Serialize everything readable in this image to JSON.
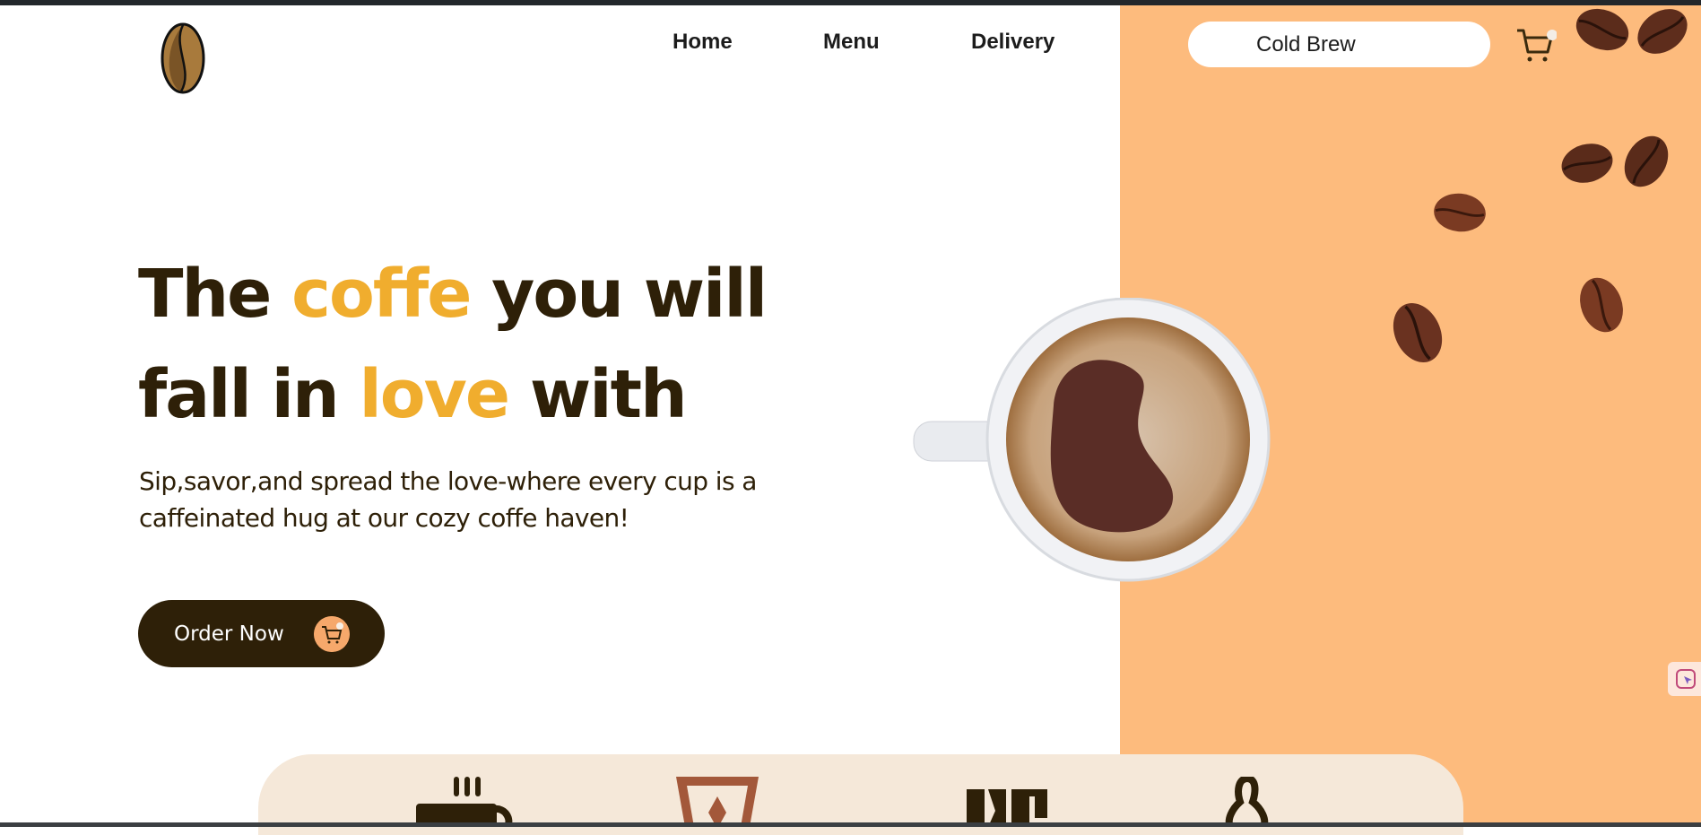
{
  "nav": {
    "items": [
      {
        "label": "Home"
      },
      {
        "label": "Menu"
      },
      {
        "label": "Delivery"
      }
    ]
  },
  "search": {
    "value": "Cold Brew"
  },
  "hero": {
    "line1": {
      "a": "The ",
      "accent": "coffe",
      "b": " you will"
    },
    "line2": {
      "a": "fall in ",
      "accent": "love",
      "b": " with"
    },
    "description": "Sip,savor,and spread the love-where every cup is a caffeinated hug at our cozy coffe haven!",
    "order_label": "Order Now"
  },
  "colors": {
    "accent": "#f0ad2e",
    "dark": "#2e2008",
    "orange": "#fdbb7d",
    "panel": "#f5e8d9"
  }
}
